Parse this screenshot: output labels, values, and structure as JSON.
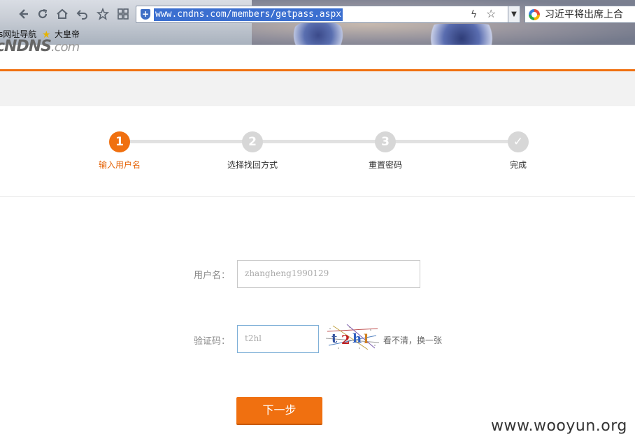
{
  "browser": {
    "url": "www.cndns.com/members/getpass.aspx",
    "search_text": "习近平将出席上合",
    "bookmarks": [
      {
        "label": "s网址导航"
      },
      {
        "label": "大皇帝"
      }
    ]
  },
  "site": {
    "logo_bold": "cNDNS",
    "logo_thin": ".com"
  },
  "steps": [
    {
      "number": "1",
      "label": "输入用户名",
      "active": true
    },
    {
      "number": "2",
      "label": "选择找回方式",
      "active": false
    },
    {
      "number": "3",
      "label": "重置密码",
      "active": false
    },
    {
      "number": "✓",
      "label": "完成",
      "active": false
    }
  ],
  "form": {
    "username_label": "用户名：",
    "username_value": "zhangheng1990129",
    "captcha_label": "验证码：",
    "captcha_value": "t2hl",
    "captcha_refresh": "看不清，换一张",
    "submit_label": "下一步"
  },
  "watermark": "www.wooyun.org",
  "colors": {
    "accent": "#f07010",
    "step_inactive": "#d7d7d7"
  }
}
